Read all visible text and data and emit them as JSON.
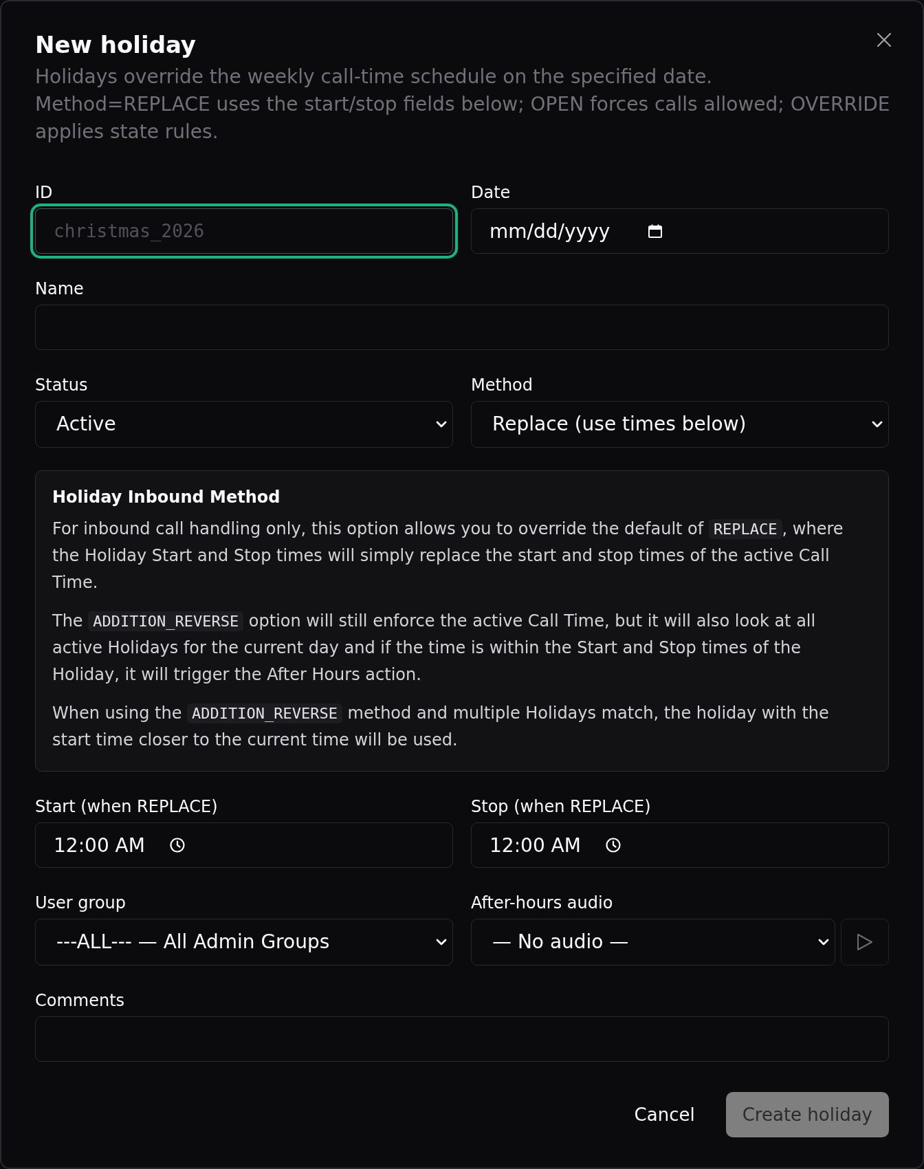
{
  "dialog": {
    "title": "New holiday",
    "description": "Holidays override the weekly call-time schedule on the specified date. Method=REPLACE uses the start/stop fields below; OPEN forces calls allowed; OVERRIDE applies state rules."
  },
  "sections": [
    {
      "kind": "row",
      "fields": [
        {
          "kind": "code",
          "label": "ID",
          "placeholder": "christmas_2026",
          "focused": true
        },
        {
          "kind": "date",
          "label": "Date",
          "placeholder": "mm/dd/yyyy",
          "focused": false
        }
      ]
    },
    {
      "kind": "row",
      "fields": [
        {
          "kind": "text",
          "label": "Name",
          "focused": false
        }
      ]
    },
    {
      "kind": "row",
      "fields": [
        {
          "kind": "select",
          "label": "Status",
          "value": "Active",
          "focused": false
        },
        {
          "kind": "select",
          "label": "Method",
          "value": "Replace (use times below)",
          "focused": false
        }
      ]
    },
    {
      "kind": "info",
      "title": "Holiday Inbound Method",
      "paragraphs": [
        [
          {
            "kind": "text",
            "text": "For inbound call handling only, this option allows you to override the default of "
          },
          {
            "kind": "code",
            "text": "REPLACE"
          },
          {
            "kind": "text",
            "text": ", where the Holiday Start and Stop times will simply replace the start and stop times of the active Call Time."
          }
        ],
        [
          {
            "kind": "text",
            "text": "The "
          },
          {
            "kind": "code",
            "text": "ADDITION_REVERSE"
          },
          {
            "kind": "text",
            "text": " option will still enforce the active Call Time, but it will also look at all active Holidays for the current day and if the time is within the Start and Stop times of the Holiday, it will trigger the After Hours action."
          }
        ],
        [
          {
            "kind": "text",
            "text": "When using the "
          },
          {
            "kind": "code",
            "text": "ADDITION_REVERSE"
          },
          {
            "kind": "text",
            "text": " method and multiple Holidays match, the holiday with the start time closer to the current time will be used."
          }
        ]
      ]
    },
    {
      "kind": "row",
      "fields": [
        {
          "kind": "time",
          "label": "Start (when REPLACE)",
          "value": "12:00 AM",
          "focused": false
        },
        {
          "kind": "time",
          "label": "Stop (when REPLACE)",
          "value": "12:00 AM",
          "focused": false
        }
      ]
    },
    {
      "kind": "row",
      "fields": [
        {
          "kind": "select",
          "label": "User group",
          "value": "---ALL--- — All Admin Groups",
          "focused": false
        },
        {
          "kind": "select",
          "label": "After-hours audio",
          "value": "— No audio —",
          "focused": false,
          "play_button": true
        }
      ]
    },
    {
      "kind": "row",
      "fields": [
        {
          "kind": "text",
          "label": "Comments",
          "focused": false
        }
      ]
    }
  ],
  "buttons": [
    {
      "kind": "plain",
      "label": "Cancel",
      "disabled": false
    },
    {
      "kind": "primary",
      "label": "Create holiday",
      "disabled": true
    }
  ]
}
